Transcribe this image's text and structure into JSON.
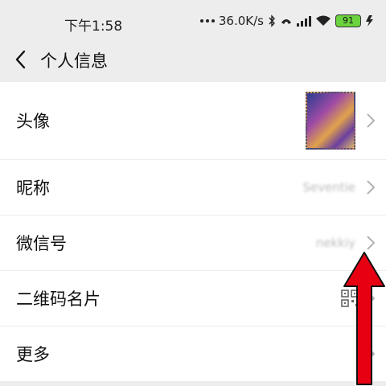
{
  "status_bar": {
    "time": "下午1:58",
    "network_speed": "36.0K/s",
    "battery": "91"
  },
  "header": {
    "title": "个人信息"
  },
  "list": {
    "items": [
      {
        "label": "头像"
      },
      {
        "label": "昵称",
        "value": "Seventie"
      },
      {
        "label": "微信号",
        "value": "nekkiy"
      },
      {
        "label": "二维码名片"
      },
      {
        "label": "更多"
      }
    ]
  },
  "colors": {
    "background": "#ededed",
    "row_background": "#ffffff",
    "arrow": "#e60012"
  }
}
